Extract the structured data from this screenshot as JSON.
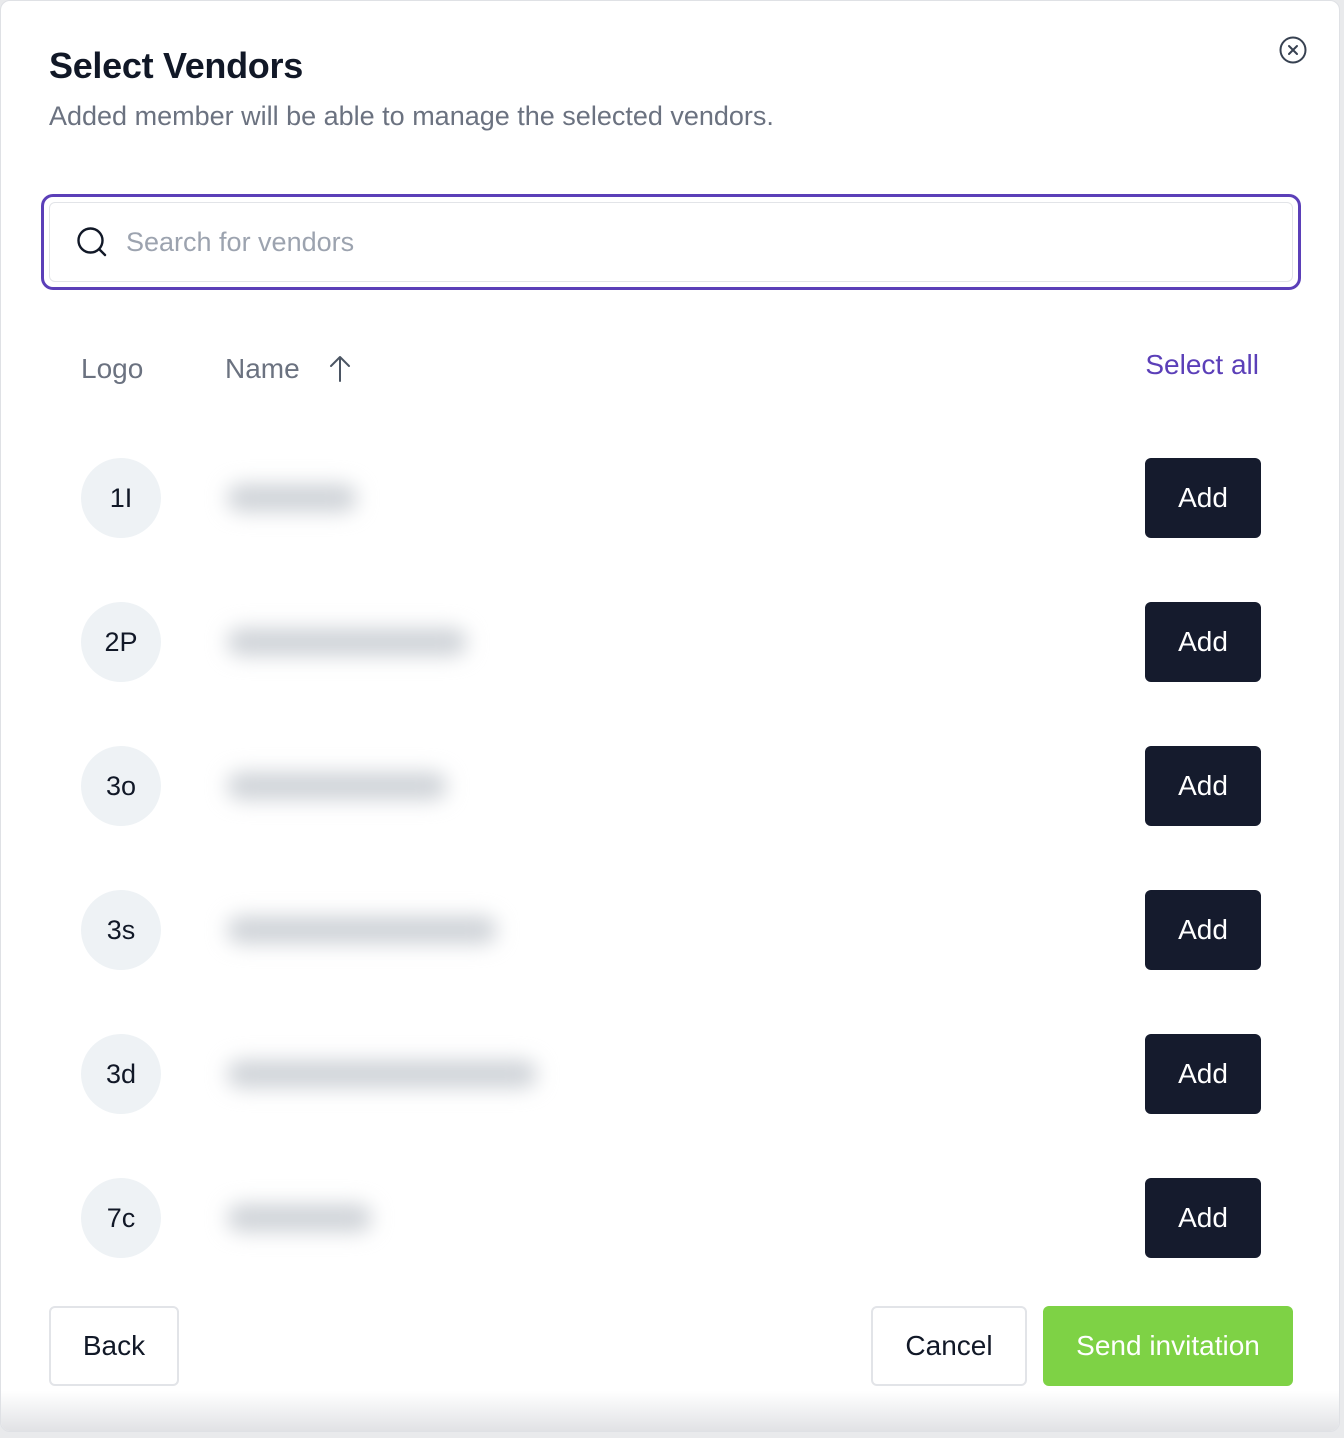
{
  "dialog": {
    "title": "Select Vendors",
    "subtitle": "Added member will be able to manage the selected vendors.",
    "close_icon": "close-circle-icon"
  },
  "search": {
    "placeholder": "Search for vendors",
    "value": "",
    "icon": "search-icon"
  },
  "table": {
    "columns": {
      "logo": "Logo",
      "name": "Name"
    },
    "sort_icon": "arrow-up-icon",
    "select_all_label": "Select all"
  },
  "vendors": [
    {
      "initials": "1I",
      "add_label": "Add"
    },
    {
      "initials": "2P",
      "add_label": "Add"
    },
    {
      "initials": "3o",
      "add_label": "Add"
    },
    {
      "initials": "3s",
      "add_label": "Add"
    },
    {
      "initials": "3d",
      "add_label": "Add"
    },
    {
      "initials": "7c",
      "add_label": "Add"
    }
  ],
  "footer": {
    "back_label": "Back",
    "cancel_label": "Cancel",
    "send_label": "Send invitation"
  },
  "colors": {
    "accent": "#5b3fb8",
    "primary_button": "#151b2d",
    "send_button": "#7ed245"
  }
}
